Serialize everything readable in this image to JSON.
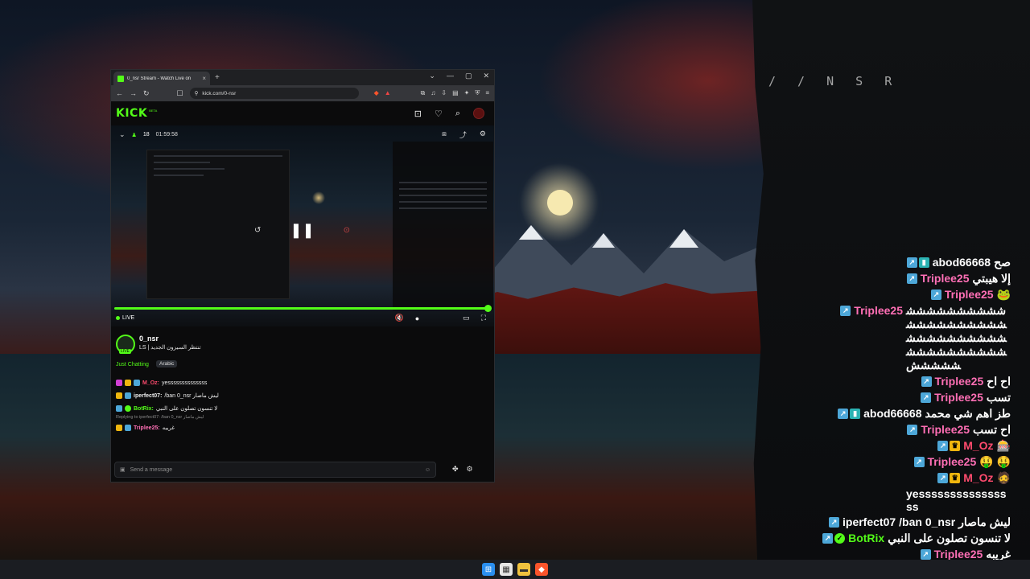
{
  "desktop": {
    "watermark": "/ /  N S R"
  },
  "browser": {
    "tab_title": "0_nsr Stream - Watch Live on",
    "tab_close": "×",
    "new_tab": "+",
    "url": "kick.com/0-nsr",
    "window_controls": [
      "⌄",
      "—",
      "▢",
      "✕"
    ]
  },
  "kick": {
    "logo": "KICK",
    "beta": "BETA",
    "viewers": "18",
    "uptime": "01:59:58",
    "live_label": "LIVE",
    "streamer": "0_nsr",
    "title": "LS | تنتظر السيزون الجديد",
    "category": "Just Chatting",
    "language": "Arabic",
    "avatar_badge": "LIVE",
    "chat_placeholder": "Send a message",
    "mini_chat": [
      {
        "user": "M_Oz:",
        "text": "yessssssssssssss",
        "color": "#ff4b6e"
      },
      {
        "user": "iperfect07:",
        "text": "/ban 0_nsr ليش ماصار",
        "color": "#ffffff"
      },
      {
        "user": "BotRix:",
        "text": "لا تنسون تصلون على النبي",
        "color": "#53fc18"
      },
      {
        "user": "Triplee25:",
        "text": "غريبه",
        "color": "#ff6fb5"
      }
    ],
    "reply_note": "Replying to iperfect07: /ban 0_nsr ليش ماصار"
  },
  "overlay_chat": [
    {
      "user": "abod66668",
      "text": "صح",
      "color": "#ffffff",
      "badges": [
        "blue",
        "teal"
      ]
    },
    {
      "user": "Triplee25",
      "text": "إلا هيبتي",
      "color": "#ff6fb5",
      "badges": [
        "blue"
      ]
    },
    {
      "user": "Triplee25",
      "text": "🐸",
      "color": "#ff6fb5",
      "badges": [
        "blue"
      ]
    },
    {
      "user": "Triplee25",
      "text": "ششششششششششششششششششششششششششششششششششششششششششششش",
      "color": "#ff6fb5",
      "badges": [
        "blue"
      ]
    },
    {
      "user": "Triplee25",
      "text": "اح اح",
      "color": "#ff6fb5",
      "badges": [
        "blue"
      ]
    },
    {
      "user": "Triplee25",
      "text": "تسب",
      "color": "#ff6fb5",
      "badges": [
        "blue"
      ]
    },
    {
      "user": "abod66668",
      "text": "طز اهم شي محمد",
      "color": "#ffffff",
      "badges": [
        "blue",
        "teal"
      ]
    },
    {
      "user": "Triplee25",
      "text": "اح تسب",
      "color": "#ff6fb5",
      "badges": [
        "blue"
      ]
    },
    {
      "user": "M_Oz",
      "text": "🎰",
      "color": "#ff4b6e",
      "badges": [
        "blue",
        "gold"
      ]
    },
    {
      "user": "Triplee25",
      "text": "🤑 🤑",
      "color": "#ff6fb5",
      "badges": [
        "blue"
      ]
    },
    {
      "user": "M_Oz",
      "text": "🧔",
      "color": "#ff4b6e",
      "badges": [
        "blue",
        "gold"
      ]
    },
    {
      "user": "",
      "text": "yessssssssssssssss",
      "color": "#ffffff",
      "badges": []
    },
    {
      "user": "iperfect07",
      "text": "/ban 0_nsr ليش ماصار",
      "color": "#ffffff",
      "badges": [
        "blue"
      ]
    },
    {
      "user": "BotRix",
      "text": "لا تنسون تصلون على النبي",
      "color": "#53fc18",
      "badges": [
        "blue",
        "green"
      ]
    },
    {
      "user": "Triplee25",
      "text": "غريبه",
      "color": "#ff6fb5",
      "badges": [
        "blue"
      ]
    }
  ]
}
